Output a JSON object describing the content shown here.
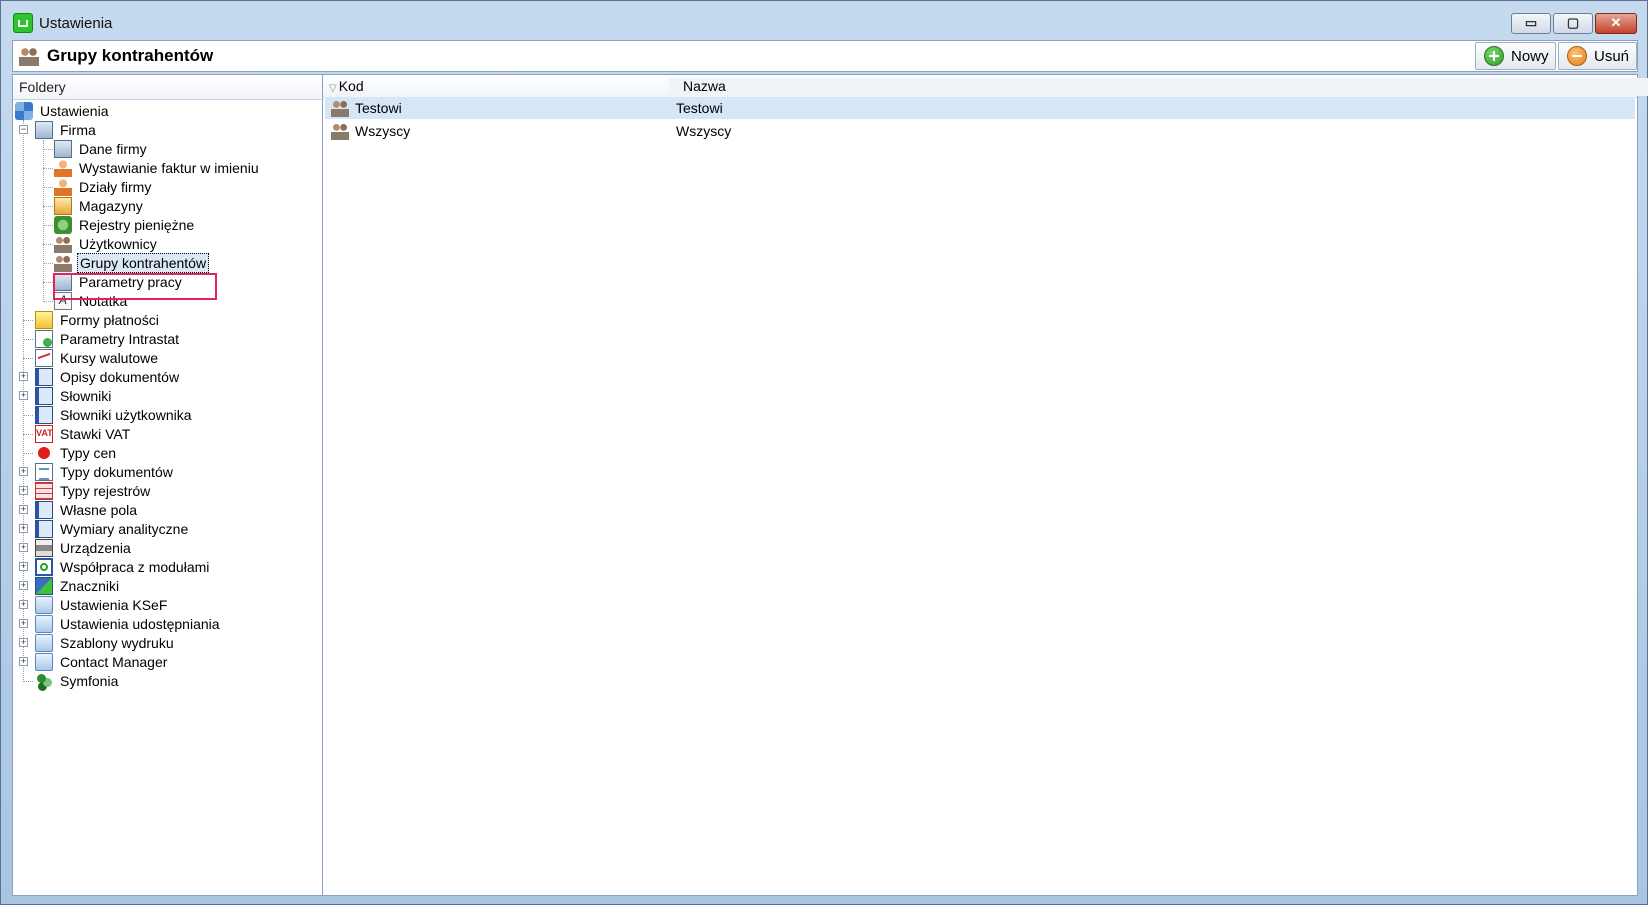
{
  "window": {
    "title": "Ustawienia",
    "minimize_glyph": "▭",
    "maximize_glyph": "▢",
    "close_glyph": "✕"
  },
  "header": {
    "title": "Grupy kontrahentów",
    "new_label": "Nowy",
    "delete_label": "Usuń"
  },
  "left": {
    "header": "Foldery",
    "tree": [
      {
        "label": "Ustawienia",
        "icon": "tools-icon"
      },
      {
        "label": "Firma",
        "icon": "company-icon"
      },
      {
        "label": "Dane firmy",
        "icon": "company-icon"
      },
      {
        "label": "Wystawianie faktur w imieniu",
        "icon": "person-icon"
      },
      {
        "label": "Działy firmy",
        "icon": "department-icon"
      },
      {
        "label": "Magazyny",
        "icon": "warehouse-icon"
      },
      {
        "label": "Rejestry pieniężne",
        "icon": "money-icon"
      },
      {
        "label": "Użytkownicy",
        "icon": "users-icon"
      },
      {
        "label": "Grupy kontrahentów",
        "icon": "groups-icon"
      },
      {
        "label": "Parametry pracy",
        "icon": "parameters-icon"
      },
      {
        "label": "Notatka",
        "icon": "note-icon"
      },
      {
        "label": "Formy płatności",
        "icon": "payment-icon"
      },
      {
        "label": "Parametry Intrastat",
        "icon": "intrastat-icon"
      },
      {
        "label": "Kursy walutowe",
        "icon": "chart-icon"
      },
      {
        "label": "Opisy dokumentów",
        "icon": "book-icon"
      },
      {
        "label": "Słowniki",
        "icon": "book-icon"
      },
      {
        "label": "Słowniki użytkownika",
        "icon": "book-icon"
      },
      {
        "label": "Stawki VAT",
        "icon": "vat-icon"
      },
      {
        "label": "Typy cen",
        "icon": "red-dot-icon"
      },
      {
        "label": "Typy dokumentów",
        "icon": "document-icon"
      },
      {
        "label": "Typy rejestrów",
        "icon": "grid-icon"
      },
      {
        "label": "Własne pola",
        "icon": "book-icon"
      },
      {
        "label": "Wymiary analityczne",
        "icon": "book-icon"
      },
      {
        "label": "Urządzenia",
        "icon": "printer-icon"
      },
      {
        "label": "Współpraca z modułami",
        "icon": "sync-icon"
      },
      {
        "label": "Znaczniki",
        "icon": "tags-icon"
      },
      {
        "label": "Ustawienia KSeF",
        "icon": "folder-icon"
      },
      {
        "label": "Ustawienia udostępniania",
        "icon": "folder-icon"
      },
      {
        "label": "Szablony wydruku",
        "icon": "folder-icon"
      },
      {
        "label": "Contact Manager",
        "icon": "folder-icon"
      },
      {
        "label": "Symfonia",
        "icon": "symfonia-icon"
      }
    ],
    "selected": "Grupy kontrahentów"
  },
  "grid": {
    "columns": {
      "kod": "Kod",
      "nazwa": "Nazwa"
    },
    "rows": [
      {
        "kod": "Testowi",
        "nazwa": "Testowi"
      },
      {
        "kod": "Wszyscy",
        "nazwa": "Wszyscy"
      }
    ]
  }
}
